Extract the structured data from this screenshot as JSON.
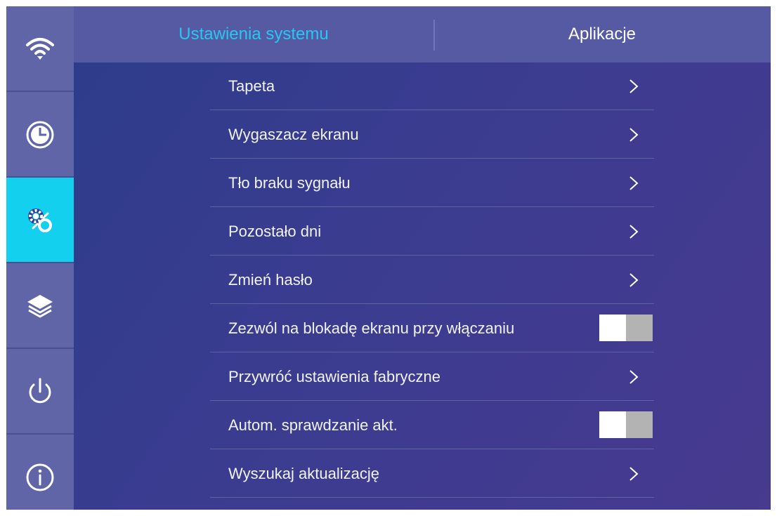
{
  "sidebar": {
    "items": [
      {
        "icon": "wifi-icon",
        "active": false
      },
      {
        "icon": "clock-icon",
        "active": false
      },
      {
        "icon": "settings-gear-icon",
        "active": true
      },
      {
        "icon": "layers-icon",
        "active": false
      },
      {
        "icon": "power-icon",
        "active": false
      },
      {
        "icon": "info-icon",
        "active": false
      }
    ],
    "active_color": "#13d0ef"
  },
  "tabs": {
    "system_label": "Ustawienia systemu",
    "apps_label": "Aplikacje",
    "active_tab": "system",
    "active_color": "#27c8f0"
  },
  "settings": {
    "wallpaper": "Tapeta",
    "screensaver": "Wygaszacz ekranu",
    "no_signal_bg": "Tło braku sygnału",
    "days_left": "Pozostało dni",
    "change_password": "Zmień hasło",
    "screen_lock_on_boot": "Zezwól na blokadę ekranu przy włączaniu",
    "screen_lock_on_boot_enabled": false,
    "factory_reset": "Przywróć ustawienia fabryczne",
    "auto_update_check": "Autom. sprawdzanie akt.",
    "auto_update_check_enabled": false,
    "check_updates": "Wyszukaj aktualizację"
  }
}
